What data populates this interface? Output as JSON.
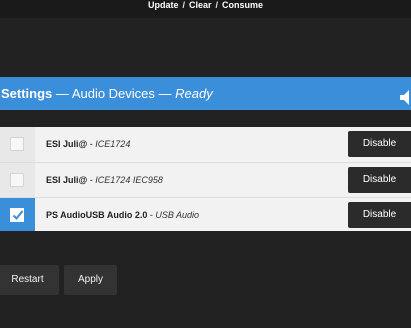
{
  "topnav": {
    "update": "Update",
    "sep1": "/",
    "clear": "Clear",
    "sep2": "/",
    "consume": "Consume"
  },
  "panel": {
    "title_settings": "Settings",
    "dash1": " — ",
    "title_section": "Audio Devices",
    "dash2": " — ",
    "status": "Ready",
    "speaker_icon": "speaker-icon"
  },
  "devices": [
    {
      "name": "ESI Juli@",
      "sep": " - ",
      "driver": "ICE1724",
      "checked": false,
      "action": "Disable"
    },
    {
      "name": "ESI Juli@",
      "sep": " - ",
      "driver": "ICE1724 IEC958",
      "checked": false,
      "action": "Disable"
    },
    {
      "name": "PS AudioUSB Audio 2.0",
      "sep": " - ",
      "driver": "USB Audio",
      "checked": true,
      "action": "Disable"
    }
  ],
  "buttons": {
    "restart": "Restart",
    "apply": "Apply"
  },
  "colors": {
    "accent": "#3b8ed9",
    "background": "#222222",
    "row_bg": "#f2f2f2",
    "button_bg": "#2b2b2b"
  }
}
